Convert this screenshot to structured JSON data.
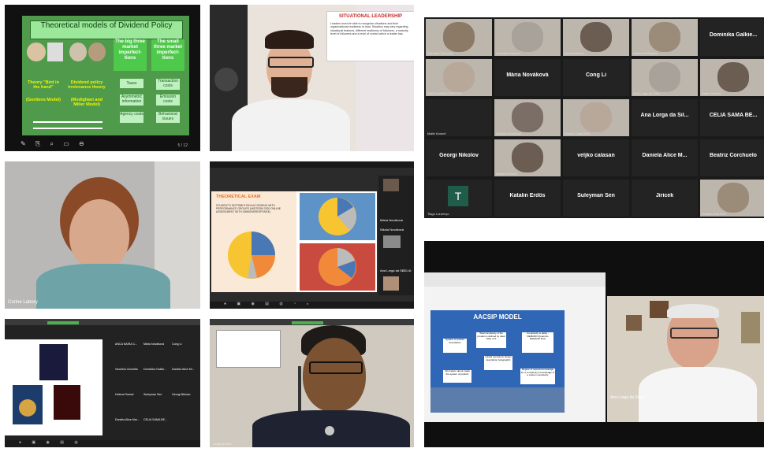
{
  "tile1": {
    "title": "Theoretical models of Dividend Policy",
    "col_headers": [
      "The big three market imperfect-tions",
      "The small three market imperfect-tions"
    ],
    "big_three": [
      "Taxes",
      "Asymmetric information",
      "Agency costs"
    ],
    "small_three": [
      "Transaction costs",
      "Emission costs",
      "Behavioral issues"
    ],
    "theory1": "Theory \"Bird in the hand\"",
    "theory1_sub": "(Gordons Model)",
    "theory2": "Dividend policy irrelevance theory",
    "theory2_sub": "(Modigliani and Miller Model)",
    "page": "5 / 12"
  },
  "tile2": {
    "slide_title": "SITUATIONAL LEADERSHIP",
    "slide_body": "Leaders must be able to recognize situations and their organizational readiness to lead. Situation may vary regarding situational features, different readiness of followers, a maturity level of followers and a level of control which a leader has."
  },
  "tile3": {
    "name": "Corine Labory"
  },
  "tile4": {
    "slide_title": "THEORETICAL EXAM",
    "slide_text": "STUDENT'S DISTRIBUTION ACCORDING WITH PERFORMANCE GROUPS (MIDTERM 2020 ONLINE ASSESSMENT WITH GIBBONSRESPONSE)",
    "side_names": [
      "Mária Nováková",
      "Nikola Nováková",
      "Ana Lorga da Sil...",
      "CELIA"
    ],
    "pie_colors": [
      "#f7c531",
      "#f08a3a",
      "#bbbbbb",
      "#4a78b5",
      "#7d6a55"
    ]
  },
  "tile5": {
    "names": [
      "ANCA NAIRA C...",
      "Mária Nováková",
      "Cong Li",
      "Veselina Vorontila",
      "Dominika Galkie...",
      "Daniela Alice Mi...",
      "Helena Roessl",
      "Suleyman Sen",
      "Georgi Nikolov",
      "Daniela Alice Mar...",
      "CELIA SAMA BE..."
    ]
  },
  "tile6": {
    "name": "Uvais Ahmed"
  },
  "grid": {
    "cells": [
      {
        "name": "",
        "label": "Marinela Kolovska",
        "video": true
      },
      {
        "name": "",
        "label": "Veronika Hrinova",
        "video": true
      },
      {
        "name": "",
        "label": "Nick Andreiev",
        "video": true
      },
      {
        "name": "",
        "label": "Helena Pellegrino",
        "video": true
      },
      {
        "name": "Dominika Galkie...",
        "label": "",
        "video": false
      },
      {
        "name": "",
        "label": "ANCA NAIRA CRISTINA",
        "video": true
      },
      {
        "name": "Mária Nováková",
        "label": "",
        "video": false
      },
      {
        "name": "Cong Li",
        "label": "",
        "video": false
      },
      {
        "name": "",
        "label": "Ana Lorga da Silva",
        "video": true
      },
      {
        "name": "",
        "label": "Helen Helena",
        "video": true
      },
      {
        "name": "",
        "label": "Malte Kanuel",
        "video": false
      },
      {
        "name": "",
        "label": "Daniela Neubauer",
        "video": true
      },
      {
        "name": "",
        "label": "Doncic Cabal Sita",
        "video": true
      },
      {
        "name": "Ana Lorga da Sil...",
        "label": "",
        "video": false
      },
      {
        "name": "CELIA SAMA BE...",
        "label": "",
        "video": false
      },
      {
        "name": "Georgi Nikolov",
        "label": "",
        "video": false
      },
      {
        "name": "",
        "label": "Nikola Gerlovic",
        "video": true
      },
      {
        "name": "veljko calasan",
        "label": "",
        "video": false
      },
      {
        "name": "Daniela Alice M...",
        "label": "",
        "video": false
      },
      {
        "name": "Beatriz Corchuelo",
        "label": "",
        "video": false
      },
      {
        "name": "T",
        "label": "Tiago Lourenço",
        "video": false
      },
      {
        "name": "Katalin Erdős",
        "label": "",
        "video": false
      },
      {
        "name": "Suleyman Sen",
        "label": "",
        "video": false
      },
      {
        "name": "Jiricek",
        "label": "",
        "video": false
      },
      {
        "name": "",
        "label": "Susana Dos Reis",
        "video": true
      }
    ]
  },
  "tile9": {
    "slide_title": "AACSIP MODEL",
    "boxes": [
      "System is product boundaries",
      "Total complexity of the product is defined by Ideal state of S",
      "Complexity is delay - DEMAND Dynamics DEMAND Flow",
      "Information about inside the system of product",
      "Global operations design description holographic",
      "Degree of required knowledge for a complexity & knowledge of a system complexity"
    ],
    "name": "Ana Lorga da Silva"
  }
}
